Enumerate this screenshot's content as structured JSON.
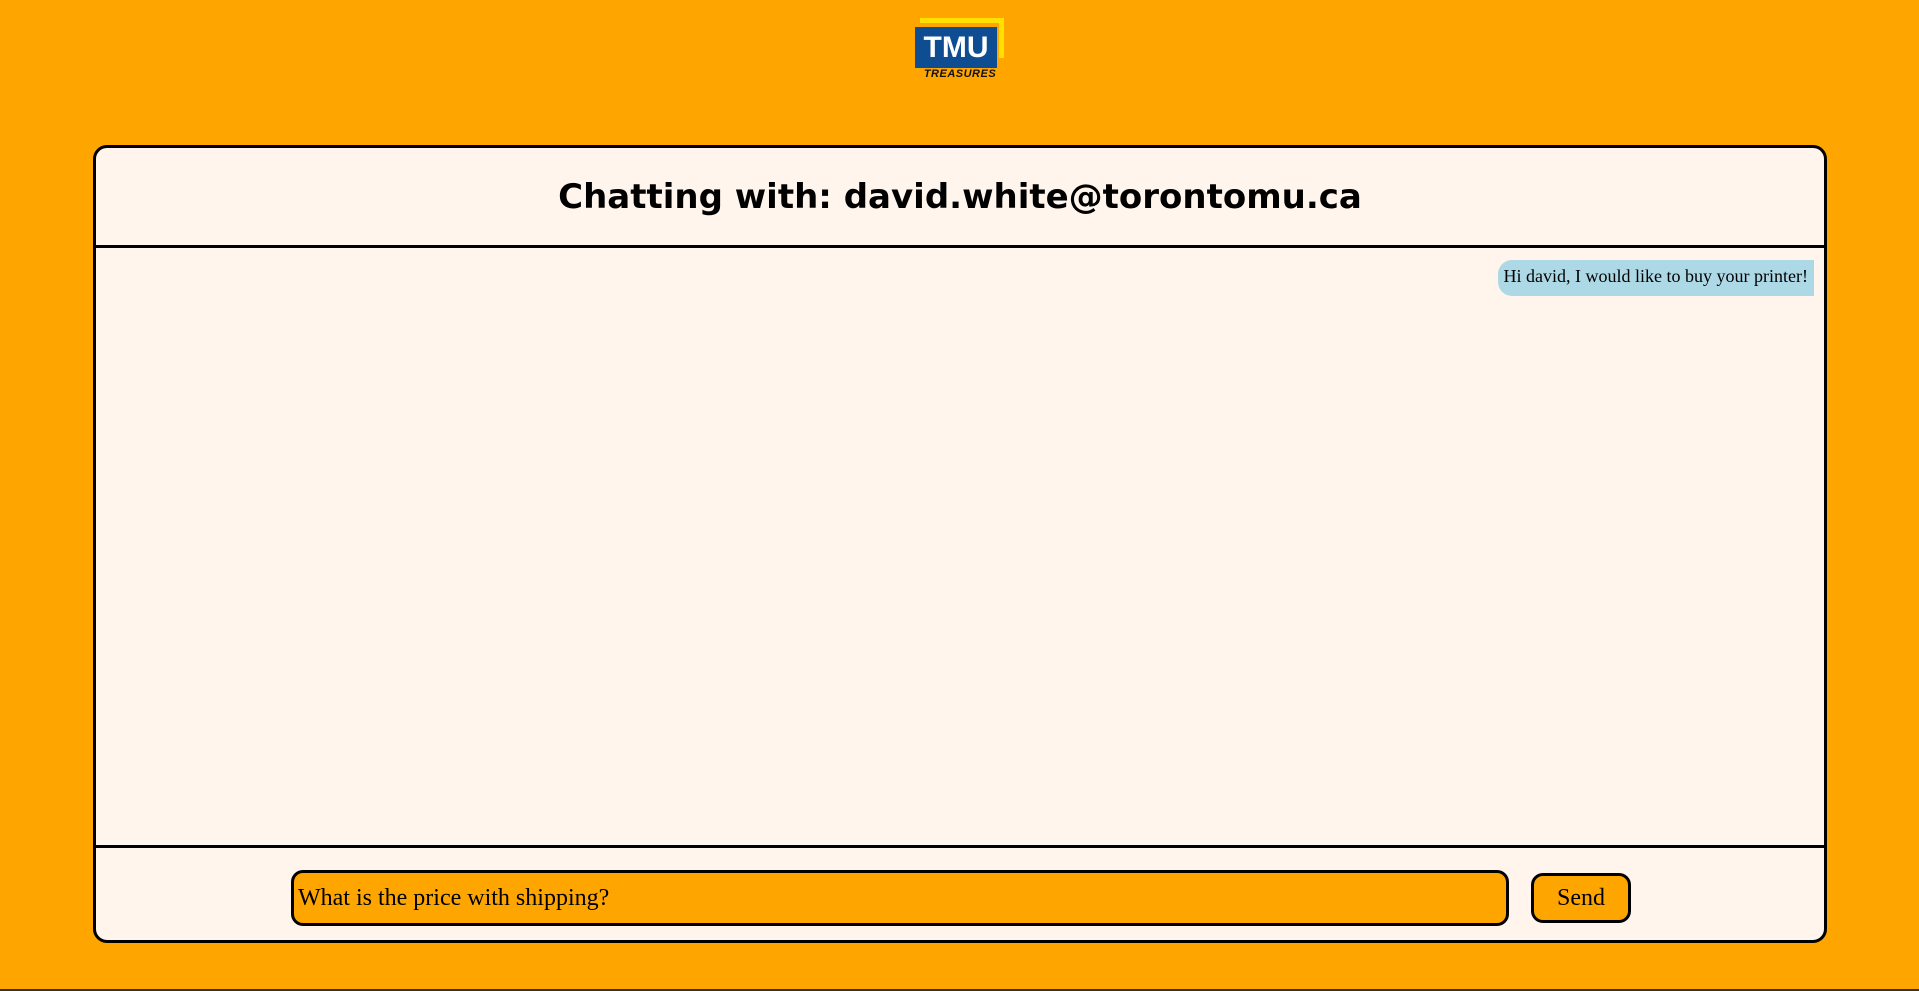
{
  "logo": {
    "main_text": "TMU",
    "sub_text": "TREASURES"
  },
  "chat": {
    "title": "Chatting with: david.white@torontomu.ca",
    "messages": [
      {
        "text": "Hi david, I would like to buy your printer!",
        "side": "right",
        "bubble_color": "#add8e6"
      }
    ]
  },
  "composer": {
    "input_value": "What is the price with shipping?",
    "send_label": "Send"
  },
  "colors": {
    "background": "#ffa500",
    "panel": "#fff5ec",
    "logo_blue": "#0e4d92",
    "logo_accent": "#ffe000"
  }
}
